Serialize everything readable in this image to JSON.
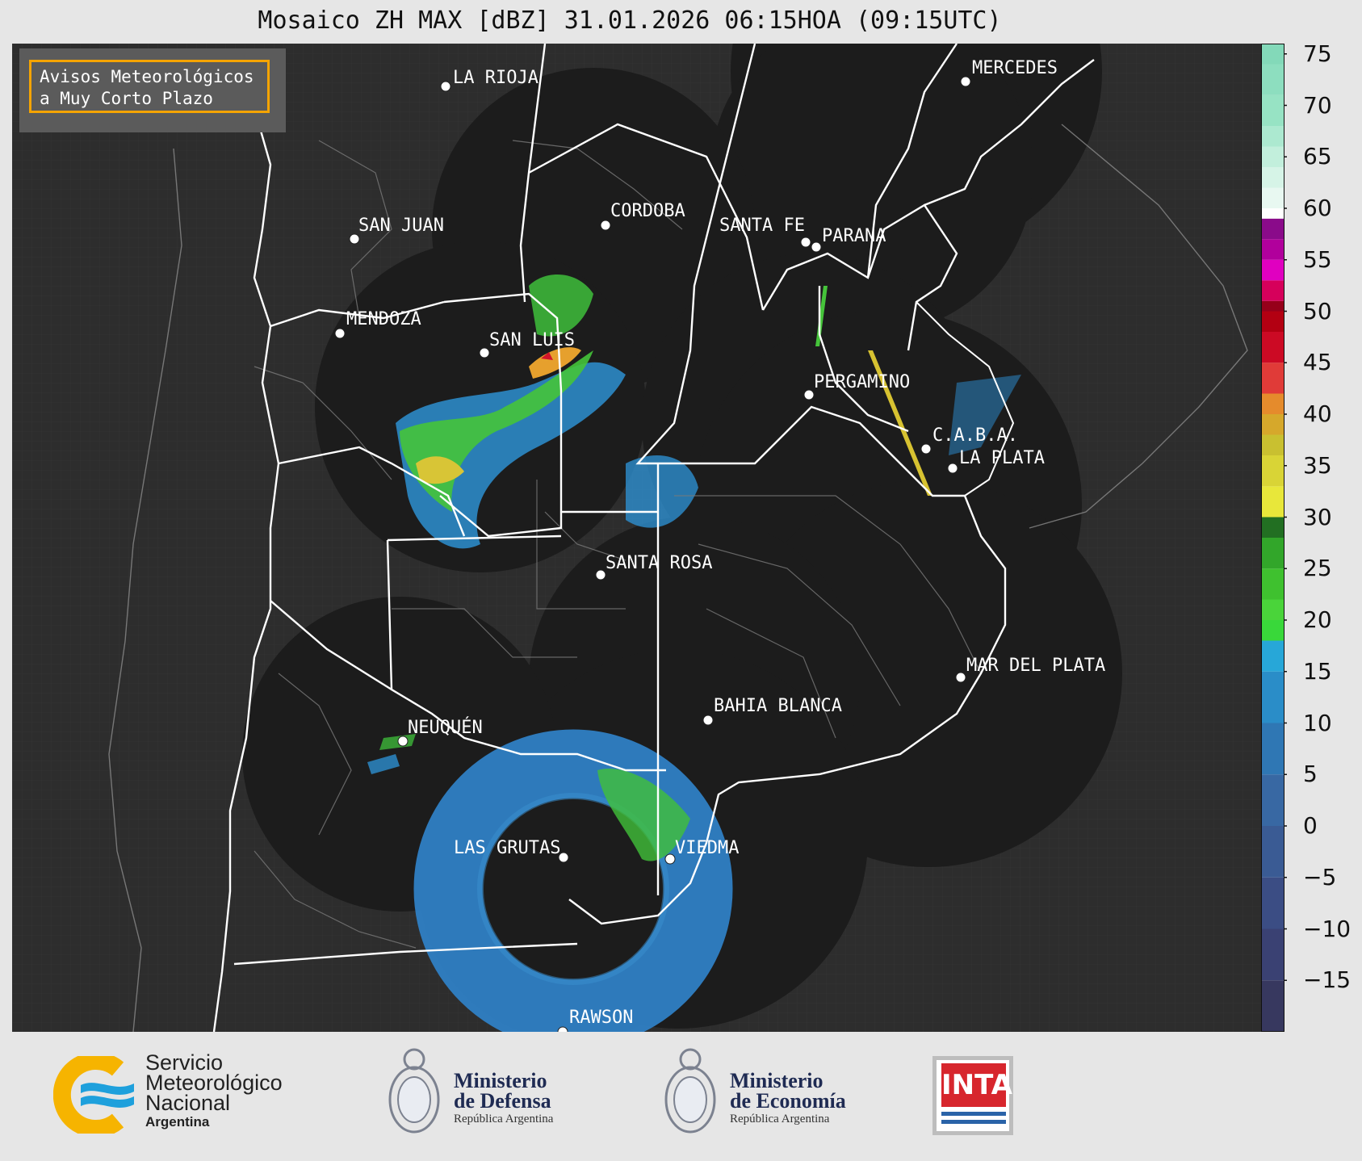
{
  "title": "Mosaico ZH MAX [dBZ] 31.01.2026 06:15HOA (09:15UTC)",
  "badge": {
    "line1": "Avisos Meteorológicos",
    "line2": "a Muy Corto Plazo"
  },
  "cities": [
    {
      "name": "LA RIOJA"
    },
    {
      "name": "MERCEDES"
    },
    {
      "name": "SAN JUAN"
    },
    {
      "name": "CORDOBA"
    },
    {
      "name": "SANTA FE"
    },
    {
      "name": "PARANA"
    },
    {
      "name": "MENDOZA"
    },
    {
      "name": "SAN LUIS"
    },
    {
      "name": "PERGAMINO"
    },
    {
      "name": "C.A.B.A."
    },
    {
      "name": "LA PLATA"
    },
    {
      "name": "SANTA ROSA"
    },
    {
      "name": "MAR DEL PLATA"
    },
    {
      "name": "BAHIA BLANCA"
    },
    {
      "name": "NEUQUÉN"
    },
    {
      "name": "LAS GRUTAS"
    },
    {
      "name": "VIEDMA"
    },
    {
      "name": "RAWSON"
    }
  ],
  "colorbar": {
    "ticks": [
      "75",
      "70",
      "65",
      "60",
      "55",
      "50",
      "45",
      "40",
      "35",
      "30",
      "25",
      "20",
      "15",
      "10",
      "5",
      "0",
      "−5",
      "−10",
      "−15"
    ],
    "stops": [
      {
        "from": -20,
        "color": "#37385f"
      },
      {
        "from": -15,
        "color": "#3a4173"
      },
      {
        "from": -10,
        "color": "#3b4d84"
      },
      {
        "from": -5,
        "color": "#3a5b94"
      },
      {
        "from": 0,
        "color": "#3868a3"
      },
      {
        "from": 5,
        "color": "#2f77b4"
      },
      {
        "from": 10,
        "color": "#2a8dc8"
      },
      {
        "from": 15,
        "color": "#27a7d8"
      },
      {
        "from": 18,
        "color": "#39d83a"
      },
      {
        "from": 20,
        "color": "#4ad43a"
      },
      {
        "from": 22,
        "color": "#3fc12f"
      },
      {
        "from": 25,
        "color": "#32a62a"
      },
      {
        "from": 28,
        "color": "#226f22"
      },
      {
        "from": 30,
        "color": "#e8e73a"
      },
      {
        "from": 33,
        "color": "#d9d436"
      },
      {
        "from": 36,
        "color": "#c9c030"
      },
      {
        "from": 38,
        "color": "#d6a82b"
      },
      {
        "from": 40,
        "color": "#e58b2c"
      },
      {
        "from": 42,
        "color": "#e03b38"
      },
      {
        "from": 45,
        "color": "#cc0a24"
      },
      {
        "from": 48,
        "color": "#b30012"
      },
      {
        "from": 50,
        "color": "#96001a"
      },
      {
        "from": 51,
        "color": "#d6005b"
      },
      {
        "from": 53,
        "color": "#e000c0"
      },
      {
        "from": 55,
        "color": "#b1009c"
      },
      {
        "from": 57,
        "color": "#8a0b8a"
      },
      {
        "from": 59,
        "color": "#ffffff"
      },
      {
        "from": 60,
        "color": "#e8f8f1"
      },
      {
        "from": 62,
        "color": "#d6f4e7"
      },
      {
        "from": 64,
        "color": "#c2efdc"
      },
      {
        "from": 66,
        "color": "#ace9d0"
      },
      {
        "from": 68,
        "color": "#97e3c4"
      },
      {
        "from": 71,
        "color": "#8ddebf"
      },
      {
        "from": 74,
        "color": "#83d9b9"
      }
    ]
  },
  "logos": {
    "smn": {
      "line1": "Servicio",
      "line2": "Meteorológico",
      "line3": "Nacional",
      "sub": "Argentina"
    },
    "defensa": {
      "line1": "Ministerio",
      "line2": "de Defensa",
      "sub": "República Argentina"
    },
    "economia": {
      "line1": "Ministerio",
      "line2": "de Economía",
      "sub": "República Argentina"
    },
    "inta": {
      "text": "INTA"
    }
  }
}
